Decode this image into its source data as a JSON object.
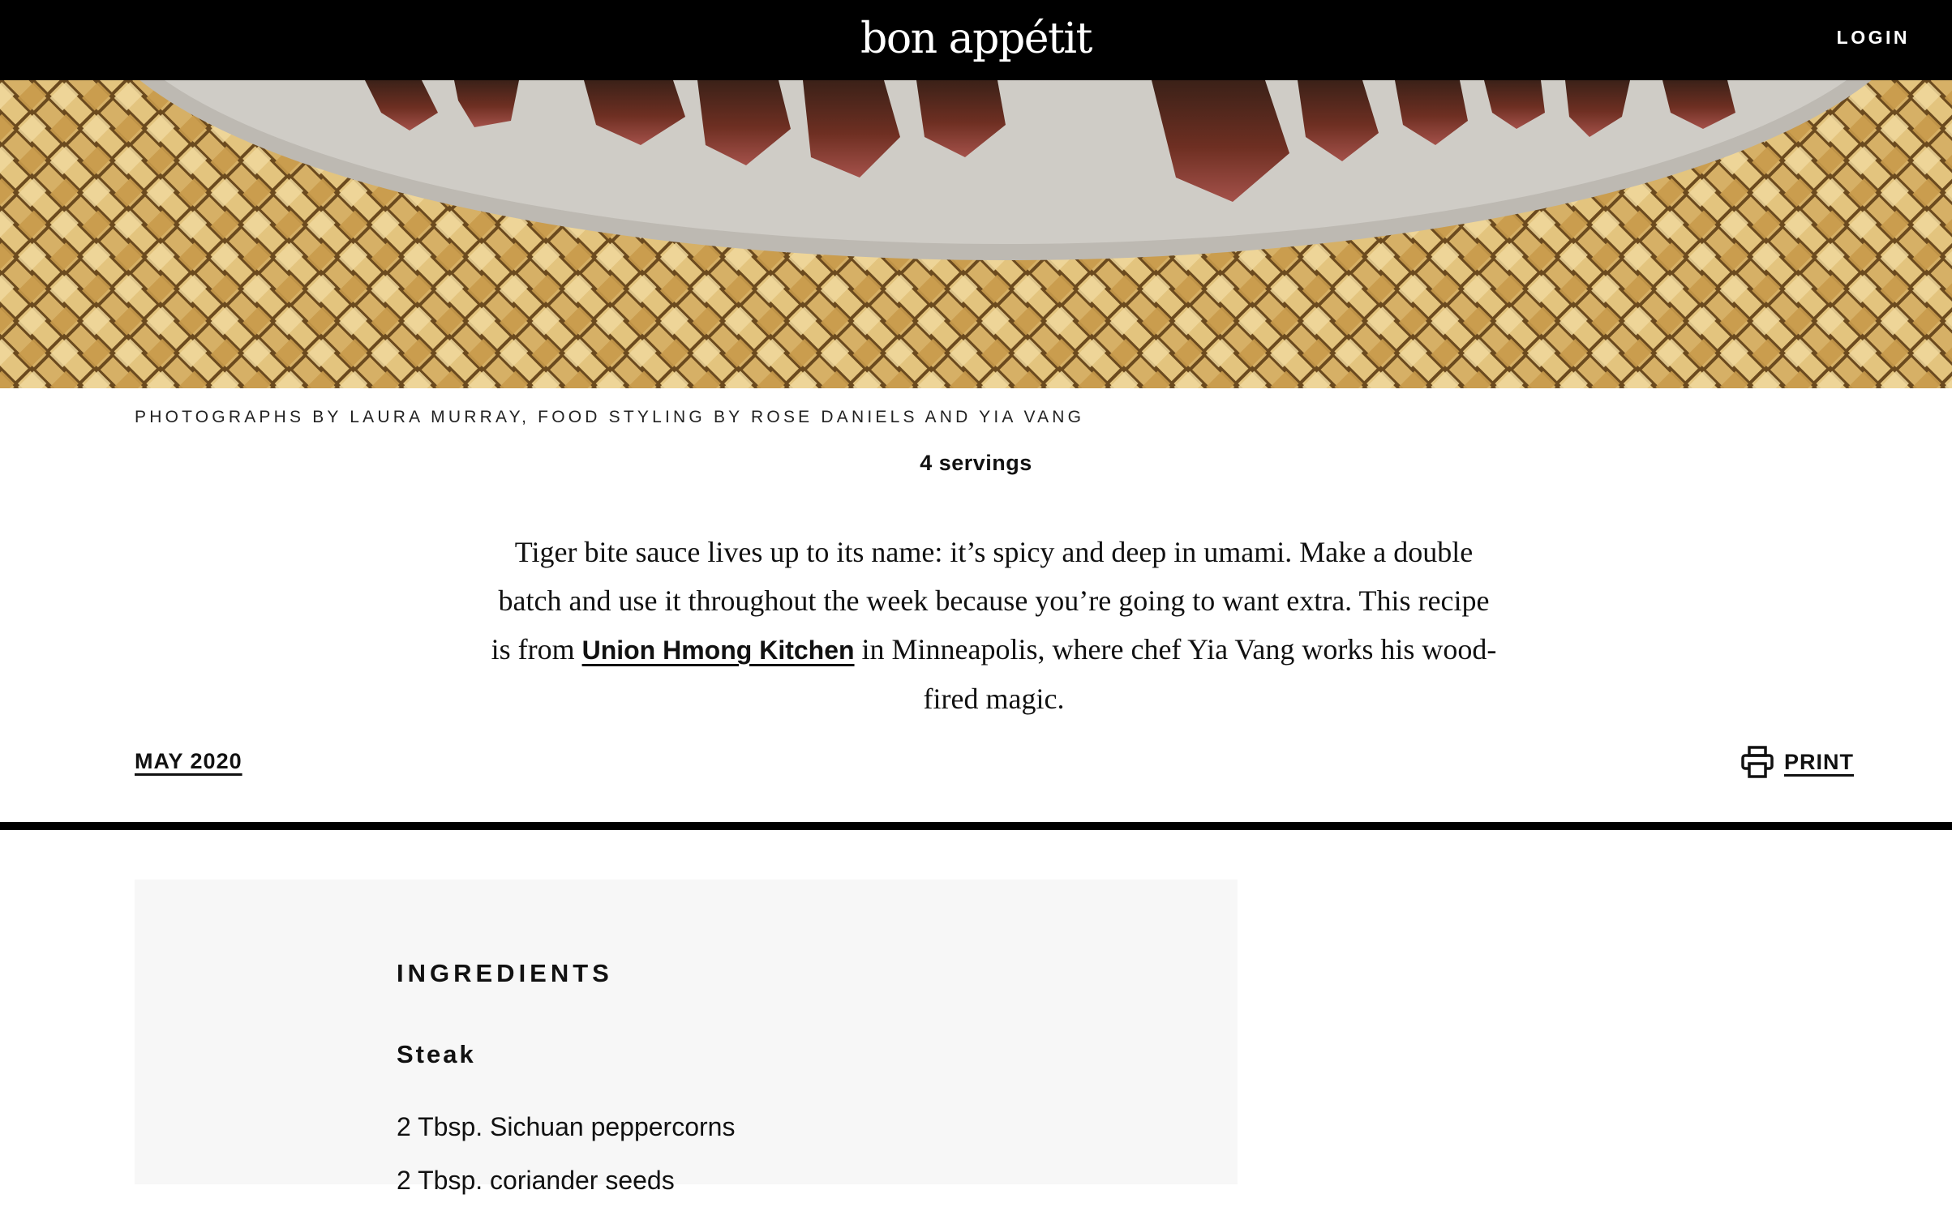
{
  "header": {
    "logo": "bon appétit",
    "login_label": "LOGIN"
  },
  "hero": {
    "description": "Photo of sliced grilled steak on a white plate over a woven bamboo mat"
  },
  "photo_credit": "Photographs by Laura Murray, Food Styling by Rose Daniels and Yia Vang",
  "servings": "4 servings",
  "description": {
    "part1": "Tiger bite sauce lives up to its name: it’s spicy and deep in umami. Make a double batch and use it throughout the week because you’re going to want extra. This recipe is from ",
    "link_text": "Union Hmong Kitchen",
    "part2": " in Minneapolis, where chef Yia Vang works his wood-fired magic."
  },
  "meta": {
    "date": "MAY 2020",
    "print_label": "PRINT",
    "print_icon": "printer-icon"
  },
  "ingredients": {
    "heading": "INGREDIENTS",
    "groups": [
      {
        "title": "Steak",
        "items": [
          "2 Tbsp. Sichuan peppercorns",
          "2 Tbsp. coriander seeds"
        ]
      }
    ]
  },
  "colors": {
    "header_bg": "#000000",
    "panel_bg": "#f7f7f7",
    "text": "#111111"
  }
}
